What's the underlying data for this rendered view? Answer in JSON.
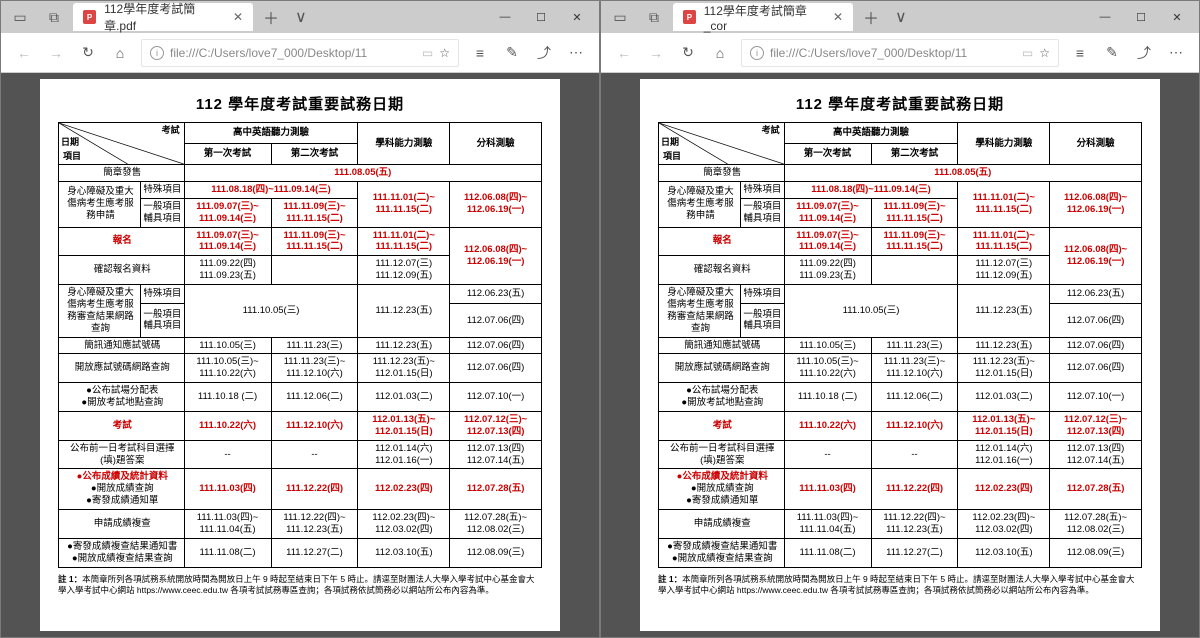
{
  "windows": [
    {
      "tab": "112學年度考試簡章.pdf",
      "url": "file:///C:/Users/love7_000/Desktop/11"
    },
    {
      "tab": "112學年度考試簡章_cor",
      "url": "file:///C:/Users/love7_000/Desktop/11"
    }
  ],
  "doc": {
    "title": "112 學年度考試重要試務日期",
    "diag": {
      "a": "考試",
      "b": "日期",
      "c": "項目"
    },
    "head": {
      "h1": "高中英語聽力測驗",
      "h2": "學科能力測驗",
      "h3": "分科測驗",
      "t1": "第一次考試",
      "t2": "第二次考試"
    },
    "rows": {
      "r1": {
        "l": "簡章發售",
        "val": "111.08.05(五)"
      },
      "r2a": {
        "l": "身心障礙及重大傷病考生應考服務申請",
        "s1": "特殊項目",
        "v1": "111.08.18(四)~111.09.14(三)",
        "v2": "111.11.01(二)~\n111.11.15(二)",
        "v3": "112.06.08(四)~\n112.06.19(一)"
      },
      "r2b": {
        "s1": "一般項目\n輔具項目",
        "v1": "111.09.07(三)~\n111.09.14(三)",
        "v2": "111.11.09(三)~\n111.11.15(二)"
      },
      "r3": {
        "l": "報名",
        "v1": "111.09.07(三)~\n111.09.14(三)",
        "v2": "111.11.09(三)~\n111.11.15(二)",
        "v3": "111.11.01(二)~\n111.11.15(二)",
        "v4": "112.06.08(四)~\n112.06.19(一)"
      },
      "r4": {
        "l": "確認報名資料",
        "v1": "111.09.22(四)\n111.09.23(五)",
        "v2": "",
        "v3": "111.12.07(三)\n111.12.09(五)",
        "v4": ""
      },
      "r5a": {
        "l": "身心障礙及重大傷病考生應考服務審查結果網路查詢",
        "s1": "特殊項目",
        "v3": "112.06.23(五)"
      },
      "r5b": {
        "s1": "一般項目\n輔具項目",
        "v1": "111.10.05(三)",
        "v2": "111.12.23(五)",
        "v3": "112.07.06(四)"
      },
      "r6": {
        "l": "簡訊通知應試號碼",
        "v1": "111.10.05(三)",
        "v2": "111.11.23(三)",
        "v3": "111.12.23(五)",
        "v4": "112.07.06(四)"
      },
      "r7": {
        "l": "開放應試號碼網路查詢",
        "v1": "111.10.05(三)~\n111.10.22(六)",
        "v2": "111.11.23(三)~\n111.12.10(六)",
        "v3": "111.12.23(五)~\n112.01.15(日)",
        "v4": "112.07.06(四)"
      },
      "r8": {
        "l": "●公布試場分配表\n●開放考試地點查詢",
        "v1": "111.10.18 (二)",
        "v2": "111.12.06(二)",
        "v3": "112.01.03(二)",
        "v4": "112.07.10(一)"
      },
      "r9": {
        "l": "考試",
        "v1": "111.10.22(六)",
        "v2": "111.12.10(六)",
        "v3": "112.01.13(五)~\n112.01.15(日)",
        "v4": "112.07.12(三)~\n112.07.13(四)"
      },
      "r10": {
        "l": "公布前一日考試科目選擇\n(填)題答案",
        "v1": "--",
        "v2": "--",
        "v3": "112.01.14(六)\n112.01.16(一)",
        "v4": "112.07.13(四)\n112.07.14(五)"
      },
      "r11": {
        "l": "●公布成績及統計資料\n●開放成績查詢\n●寄發成績通知單",
        "v1": "111.11.03(四)",
        "v2": "111.12.22(四)",
        "v3": "112.02.23(四)",
        "v4": "112.07.28(五)"
      },
      "r12": {
        "l": "申請成績複查",
        "v1": "111.11.03(四)~\n111.11.04(五)",
        "v2": "111.12.22(四)~\n111.12.23(五)",
        "v3": "112.02.23(四)~\n112.03.02(四)",
        "v4": "112.07.28(五)~\n112.08.02(三)"
      },
      "r13": {
        "l": "●寄發成績複查結果通知書\n●開放成績複查結果查詢",
        "v1": "111.11.08(二)",
        "v2": "111.12.27(二)",
        "v3": "112.03.10(五)",
        "v4": "112.08.09(三)"
      }
    },
    "note": "註 1：本簡章所列各項試務系統開放時間為開放日上午 9 時起至結束日下午 5 時止。請逕至財團法人大學入學考試中心基金會大學入學考試中心網站 https://www.ceec.edu.tw 各項考試試務專區查詢；各項試務依試簡務必以網站所公布內容為準。"
  }
}
